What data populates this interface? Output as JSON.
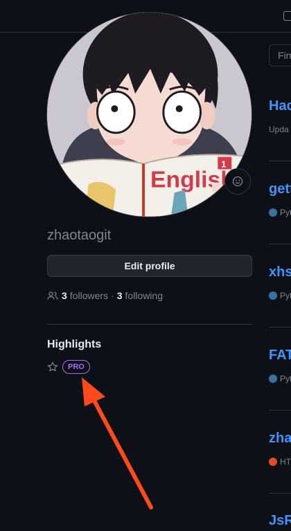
{
  "profile": {
    "username": "zhaotaogit",
    "edit_label": "Edit profile",
    "followers_count": "3",
    "followers_label": "followers",
    "separator": "·",
    "following_count": "3",
    "following_label": "following"
  },
  "highlights": {
    "title": "Highlights",
    "badge": "PRO"
  },
  "avatar": {
    "book_text": "English",
    "book_number": "1"
  },
  "search": {
    "placeholder": "Fin"
  },
  "repos": [
    {
      "name": "Hac",
      "meta": "Upda"
    },
    {
      "name": "gett",
      "meta": "Pyt",
      "lang_color": "#3572A5"
    },
    {
      "name": "xhs",
      "meta": "Pyt",
      "lang_color": "#3572A5"
    },
    {
      "name": "FAT",
      "meta": "Pyt",
      "lang_color": "#3572A5"
    },
    {
      "name": "zha",
      "meta": "HT",
      "lang_color": "#e34c26"
    },
    {
      "name": "JsR",
      "meta": ""
    }
  ],
  "colors": {
    "background": "#0d1117",
    "link": "#4493f8",
    "pro_badge": "#a371f7",
    "annotation_arrow": "#ff4a1c"
  }
}
